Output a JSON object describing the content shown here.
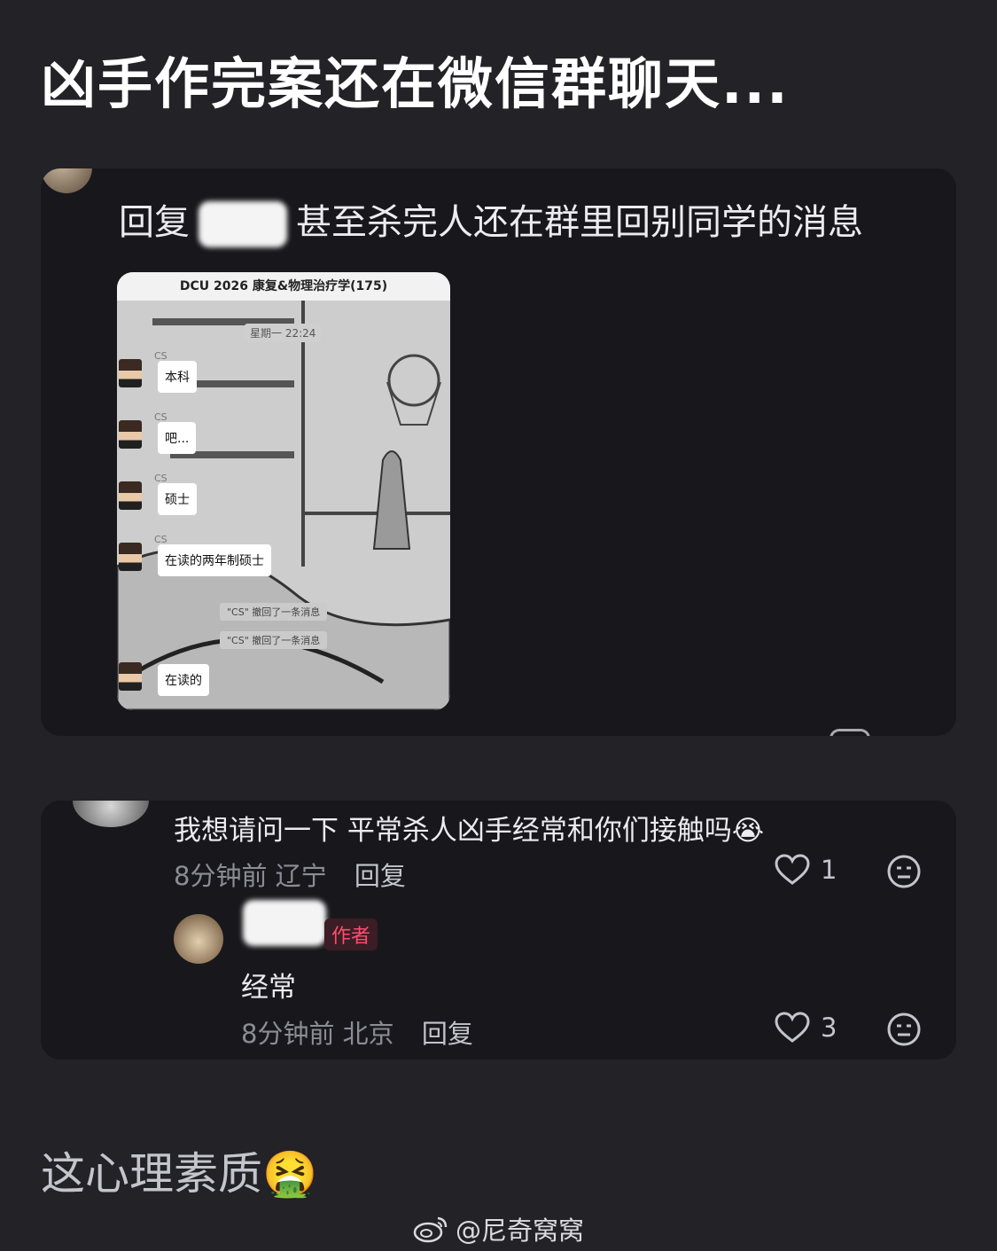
{
  "title": "凶手作完案还在微信群聊天...",
  "card1": {
    "reply_prefix": "回复",
    "reply_text": "甚至杀完人还在群里回别同学的消息",
    "screenshot": {
      "group_name": "DCU 2026 康复&物理治疗学(175)",
      "timestamp": "星期一 22:24",
      "sender": "CS",
      "messages": [
        "本科",
        "吧...",
        "硕士",
        "在读的两年制硕士"
      ],
      "recalls": [
        "\"CS\" 撤回了一条消息",
        "\"CS\" 撤回了一条消息"
      ],
      "last_message": "在读的"
    }
  },
  "comment": {
    "text": "我想请问一下 平常杀人凶手经常和你们接触吗",
    "emoji": "😭",
    "time": "8分钟前",
    "location": "辽宁",
    "reply_label": "回复",
    "likes": "1"
  },
  "sub_comment": {
    "author_badge": "作者",
    "text": "经常",
    "time": "8分钟前",
    "location": "北京",
    "reply_label": "回复",
    "likes": "3"
  },
  "bottom_caption": "这心理素质",
  "bottom_emoji": "🤮",
  "watermark": "@尼奇窝窝",
  "colors": {
    "background": "#222227",
    "card": "#18181c",
    "author_badge": "#ff4d6d"
  }
}
